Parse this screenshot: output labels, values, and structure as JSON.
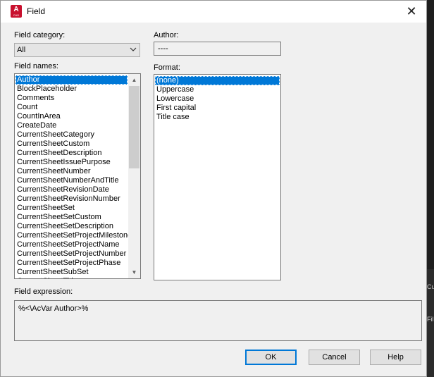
{
  "window": {
    "title": "Field",
    "app_icon_letter": "A"
  },
  "field_category": {
    "label": "Field category:",
    "value": "All"
  },
  "author": {
    "label": "Author:",
    "value": "----"
  },
  "field_names": {
    "label": "Field names:",
    "items": [
      "Author",
      "BlockPlaceholder",
      "Comments",
      "Count",
      "CountInArea",
      "CreateDate",
      "CurrentSheetCategory",
      "CurrentSheetCustom",
      "CurrentSheetDescription",
      "CurrentSheetIssuePurpose",
      "CurrentSheetNumber",
      "CurrentSheetNumberAndTitle",
      "CurrentSheetRevisionDate",
      "CurrentSheetRevisionNumber",
      "CurrentSheetSet",
      "CurrentSheetSetCustom",
      "CurrentSheetSetDescription",
      "CurrentSheetSetProjectMilestone",
      "CurrentSheetSetProjectName",
      "CurrentSheetSetProjectNumber",
      "CurrentSheetSetProjectPhase",
      "CurrentSheetSubSet",
      "CurrentSheetTitle"
    ],
    "selected": "Author"
  },
  "format": {
    "label": "Format:",
    "items": [
      "(none)",
      "Uppercase",
      "Lowercase",
      "First capital",
      "Title case"
    ],
    "selected": "(none)"
  },
  "field_expression": {
    "label": "Field expression:",
    "value": "%<\\AcVar Author>%"
  },
  "buttons": {
    "ok": "OK",
    "cancel": "Cancel",
    "help": "Help"
  },
  "background_fragments": [
    "Cu",
    "Fil"
  ]
}
